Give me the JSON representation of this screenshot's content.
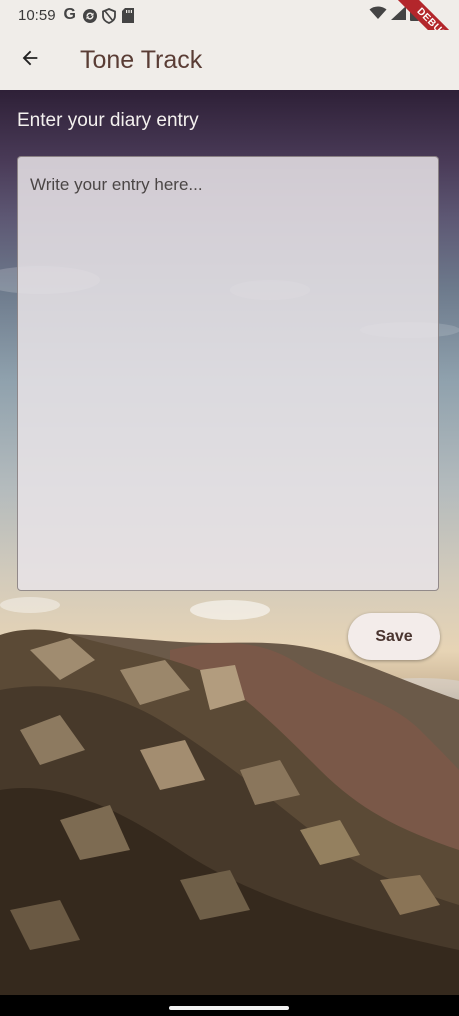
{
  "status_bar": {
    "time": "10:59",
    "google_letter": "G",
    "icons": [
      "google-icon",
      "sync-icon",
      "shield-icon",
      "sd-card-icon",
      "wifi-icon",
      "cell-signal-icon",
      "battery-icon"
    ]
  },
  "debug_banner": {
    "label": "DEBUG"
  },
  "app_bar": {
    "back_icon": "arrow-back-icon",
    "title": "Tone Track"
  },
  "form": {
    "label": "Enter your diary entry",
    "entry_placeholder": "Write your entry here...",
    "entry_value": "",
    "save_label": "Save"
  },
  "colors": {
    "app_bar_bg": "#f0ede9",
    "title_color": "#5a3d35",
    "button_bg": "#f3ecea",
    "button_text": "#4a3530",
    "debug_red": "#b3262b"
  }
}
